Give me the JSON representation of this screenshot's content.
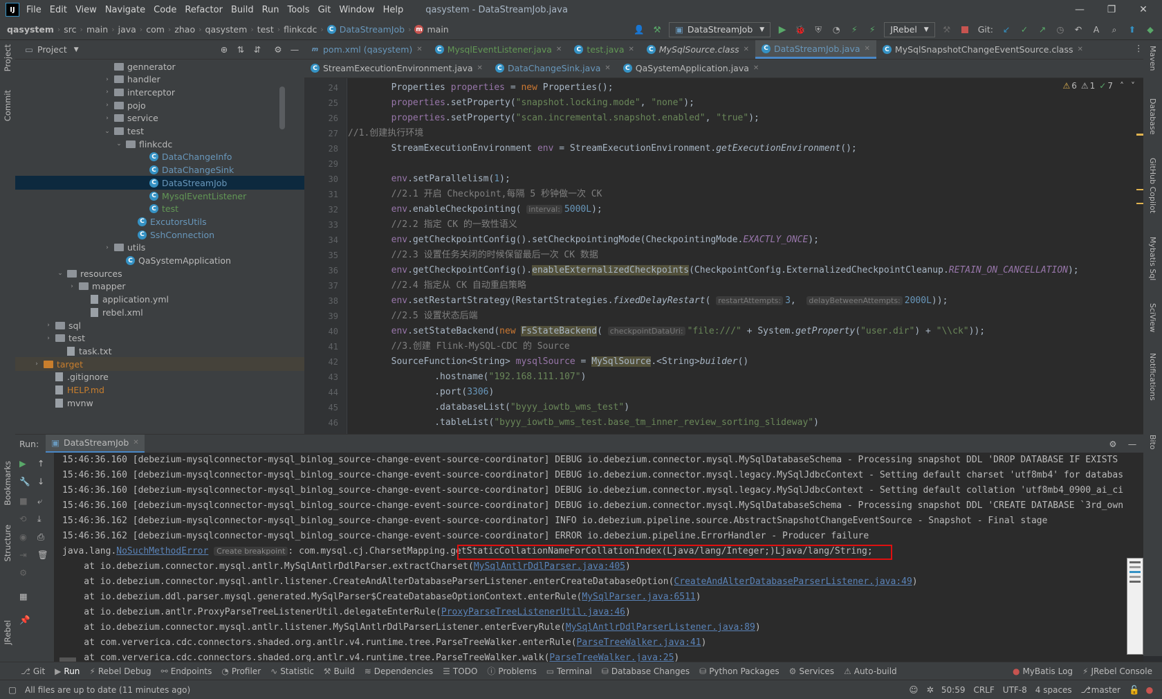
{
  "title": {
    "app_logo": "IJ",
    "menu": [
      "File",
      "Edit",
      "View",
      "Navigate",
      "Code",
      "Refactor",
      "Build",
      "Run",
      "Tools",
      "Git",
      "Window",
      "Help"
    ],
    "window_title": "qasystem - DataStreamJob.java"
  },
  "breadcrumbs": [
    "qasystem",
    "src",
    "main",
    "java",
    "com",
    "zhao",
    "qasystem",
    "test",
    "flinkcdc",
    "DataStreamJob",
    "main"
  ],
  "toolbar": {
    "run_config": "DataStreamJob",
    "jrebel": "JRebel",
    "git_label": "Git:"
  },
  "project": {
    "header": "Project",
    "tree": [
      {
        "label": "gennerator",
        "type": "folder",
        "depth": 7,
        "arrow": ""
      },
      {
        "label": "handler",
        "type": "folder",
        "depth": 7,
        "arrow": "›"
      },
      {
        "label": "interceptor",
        "type": "folder",
        "depth": 7,
        "arrow": "›"
      },
      {
        "label": "pojo",
        "type": "folder",
        "depth": 7,
        "arrow": "›"
      },
      {
        "label": "service",
        "type": "folder",
        "depth": 7,
        "arrow": "›"
      },
      {
        "label": "test",
        "type": "folder",
        "depth": 7,
        "arrow": "⌄"
      },
      {
        "label": "flinkcdc",
        "type": "folder",
        "depth": 8,
        "arrow": "⌄"
      },
      {
        "label": "DataChangeInfo",
        "type": "class",
        "depth": 10,
        "arrow": "",
        "color": "#6897bb"
      },
      {
        "label": "DataChangeSink",
        "type": "class",
        "depth": 10,
        "arrow": "",
        "color": "#6897bb"
      },
      {
        "label": "DataStreamJob",
        "type": "class",
        "depth": 10,
        "arrow": "",
        "color": "#6897bb",
        "selected": true
      },
      {
        "label": "MysqlEventListener",
        "type": "class",
        "depth": 10,
        "arrow": "",
        "color": "#629755"
      },
      {
        "label": "test",
        "type": "class",
        "depth": 10,
        "arrow": "",
        "color": "#629755"
      },
      {
        "label": "ExcutorsUtils",
        "type": "class",
        "depth": 9,
        "arrow": "",
        "color": "#6897bb"
      },
      {
        "label": "SshConnection",
        "type": "class",
        "depth": 9,
        "arrow": "",
        "color": "#6897bb"
      },
      {
        "label": "utils",
        "type": "folder",
        "depth": 7,
        "arrow": "›"
      },
      {
        "label": "QaSystemApplication",
        "type": "class",
        "depth": 8,
        "arrow": ""
      },
      {
        "label": "resources",
        "type": "folder",
        "depth": 3,
        "arrow": "⌄"
      },
      {
        "label": "mapper",
        "type": "folder",
        "depth": 4,
        "arrow": "›"
      },
      {
        "label": "application.yml",
        "type": "file",
        "depth": 5,
        "arrow": ""
      },
      {
        "label": "rebel.xml",
        "type": "file",
        "depth": 5,
        "arrow": ""
      },
      {
        "label": "sql",
        "type": "folder",
        "depth": 2,
        "arrow": "›"
      },
      {
        "label": "test",
        "type": "folder",
        "depth": 2,
        "arrow": "›"
      },
      {
        "label": "task.txt",
        "type": "file",
        "depth": 3,
        "arrow": ""
      },
      {
        "label": "target",
        "type": "folder-orange",
        "depth": 1,
        "arrow": "›",
        "color": "#c87e2d",
        "highlight": true
      },
      {
        "label": ".gitignore",
        "type": "file",
        "depth": 2,
        "arrow": ""
      },
      {
        "label": "HELP.md",
        "type": "file",
        "depth": 2,
        "arrow": "",
        "color": "#c87e2d"
      },
      {
        "label": "mvnw",
        "type": "file",
        "depth": 2,
        "arrow": ""
      }
    ]
  },
  "tabs_row1": [
    {
      "label": "pom.xml (qasystem)",
      "icon": "m",
      "color": "#6897bb"
    },
    {
      "label": "MysqlEventListener.java",
      "icon": "c",
      "color": "#629755"
    },
    {
      "label": "test.java",
      "icon": "c",
      "color": "#629755"
    },
    {
      "label": "MySqlSource.class",
      "icon": "c",
      "color": "#bbbbbb",
      "italic": true
    },
    {
      "label": "DataStreamJob.java",
      "icon": "c",
      "color": "#6897bb",
      "active": true
    },
    {
      "label": "MySqlSnapshotChangeEventSource.class",
      "icon": "c",
      "color": "#bbbbbb"
    }
  ],
  "tabs_row2": [
    {
      "label": "StreamExecutionEnvironment.java",
      "icon": "c",
      "color": "#bbbbbb"
    },
    {
      "label": "DataChangeSink.java",
      "icon": "c",
      "color": "#6897bb"
    },
    {
      "label": "QaSystemApplication.java",
      "icon": "c",
      "color": "#bbbbbb"
    }
  ],
  "editor": {
    "inspections": {
      "warn1": "6",
      "warn2": "1",
      "ok": "7"
    },
    "line_numbers": [
      "24",
      "25",
      "26",
      "27",
      "28",
      "29",
      "30",
      "31",
      "32",
      "33",
      "34",
      "35",
      "36",
      "37",
      "38",
      "39",
      "40",
      "41",
      "42",
      "43",
      "44",
      "45",
      "46"
    ],
    "hints": {
      "interval": "interval:",
      "restartAttempts": "restartAttempts:",
      "delay": "delayBetweenAttempts:",
      "checkpointDataUri": "checkpointDataUri:"
    }
  },
  "run": {
    "label": "Run:",
    "tab": "DataStreamJob",
    "lines": [
      "15:46:36.160 [debezium-mysqlconnector-mysql_binlog_source-change-event-source-coordinator] DEBUG io.debezium.connector.mysql.MySqlDatabaseSchema - Processing snapshot DDL 'DROP DATABASE IF EXISTS",
      "15:46:36.160 [debezium-mysqlconnector-mysql_binlog_source-change-event-source-coordinator] DEBUG io.debezium.connector.mysql.legacy.MySqlJdbcContext - Setting default charset 'utf8mb4' for databas",
      "15:46:36.160 [debezium-mysqlconnector-mysql_binlog_source-change-event-source-coordinator] DEBUG io.debezium.connector.mysql.legacy.MySqlJdbcContext - Setting default collation 'utf8mb4_0900_ai_ci",
      "15:46:36.160 [debezium-mysqlconnector-mysql_binlog_source-change-event-source-coordinator] DEBUG io.debezium.connector.mysql.MySqlDatabaseSchema - Processing snapshot DDL 'CREATE DATABASE `3rd_own",
      "15:46:36.162 [debezium-mysqlconnector-mysql_binlog_source-change-event-source-coordinator] INFO io.debezium.pipeline.source.AbstractSnapshotChangeEventSource - Snapshot - Final stage",
      "15:46:36.162 [debezium-mysqlconnector-mysql_binlog_source-change-event-source-coordinator] ERROR io.debezium.pipeline.ErrorHandler - Producer failure"
    ],
    "exception_prefix": "java.lang.",
    "exception_name": "NoSuchMethodError",
    "create_breakpoint": "Create breakpoint",
    "exception_mid": ": com.mysql.cj.CharsetMapping.",
    "exception_method": "getStaticCollationNameForCollationIndex(Ljava/lang/Integer;)Ljava/lang/String;",
    "stack": [
      {
        "at": "    at io.debezium.connector.mysql.antlr.MySqlAntlrDdlParser.extractCharset(",
        "link": "MySqlAntlrDdlParser.java:405",
        "end": ")"
      },
      {
        "at": "    at io.debezium.connector.mysql.antlr.listener.CreateAndAlterDatabaseParserListener.enterCreateDatabaseOption(",
        "link": "CreateAndAlterDatabaseParserListener.java:49",
        "end": ")"
      },
      {
        "at": "    at io.debezium.ddl.parser.mysql.generated.MySqlParser$CreateDatabaseOptionContext.enterRule(",
        "link": "MySqlParser.java:6511",
        "end": ")"
      },
      {
        "at": "    at io.debezium.antlr.ProxyParseTreeListenerUtil.delegateEnterRule(",
        "link": "ProxyParseTreeListenerUtil.java:46",
        "end": ")"
      },
      {
        "at": "    at io.debezium.connector.mysql.antlr.listener.MySqlAntlrDdlParserListener.enterEveryRule(",
        "link": "MySqlAntlrDdlParserListener.java:89",
        "end": ")"
      },
      {
        "at": "    at com.ververica.cdc.connectors.shaded.org.antlr.v4.runtime.tree.ParseTreeWalker.enterRule(",
        "link": "ParseTreeWalker.java:41",
        "end": ")"
      },
      {
        "at": "    at com.ververica.cdc.connectors.shaded.org.antlr.v4.runtime.tree.ParseTreeWalker.walk(",
        "link": "ParseTreeWalker.java:25",
        "end": ")"
      }
    ]
  },
  "bottom_tools": [
    "Git",
    "Run",
    "Rebel Debug",
    "Endpoints",
    "Profiler",
    "Statistic",
    "Build",
    "Dependencies",
    "TODO",
    "Problems",
    "Terminal",
    "Database Changes",
    "Python Packages",
    "Services",
    "Auto-build"
  ],
  "bottom_right_tools": [
    "MyBatis Log",
    "JRebel Console"
  ],
  "status": {
    "message": "All files are up to date (11 minutes ago)",
    "position": "50:59",
    "line_sep": "CRLF",
    "encoding": "UTF-8",
    "indent": "4 spaces",
    "branch": "master"
  },
  "left_strip": [
    "Project",
    "Commit",
    "Bookmarks",
    "Structure",
    "JRebel"
  ],
  "right_strip": [
    "Maven",
    "Database",
    "GitHub Copilot",
    "Mybatis Sql",
    "SciView",
    "Notifications",
    "Bito"
  ]
}
